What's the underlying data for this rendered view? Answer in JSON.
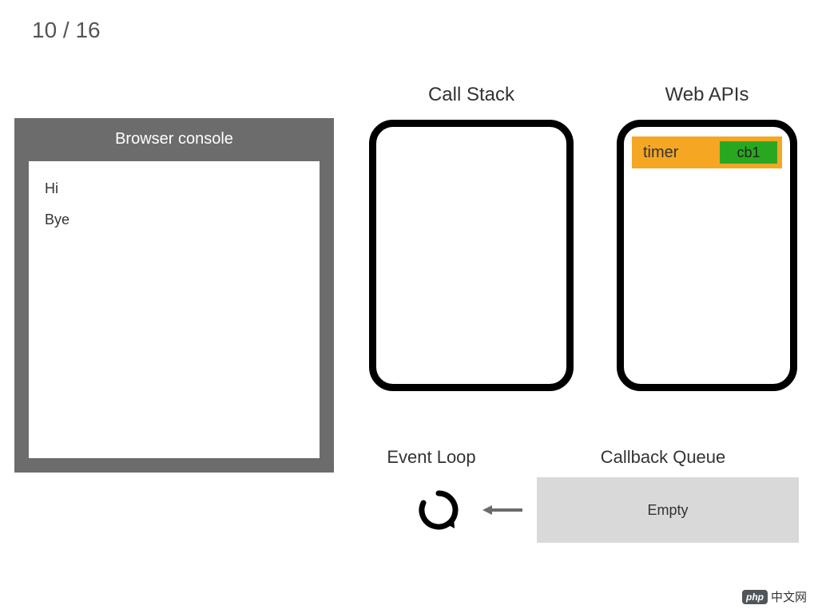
{
  "page": {
    "current": 10,
    "total": 16,
    "label": "10 / 16"
  },
  "console": {
    "title": "Browser console",
    "lines": [
      "Hi",
      "Bye"
    ]
  },
  "sections": {
    "call_stack": "Call Stack",
    "web_apis": "Web APIs",
    "event_loop": "Event Loop",
    "callback_queue": "Callback Queue"
  },
  "web_apis_entries": [
    {
      "label": "timer",
      "callback": "cb1"
    }
  ],
  "callback_queue": {
    "status": "Empty"
  },
  "colors": {
    "console_frame": "#6c6c6c",
    "timer_bg": "#f5a623",
    "callback_bg": "#2aa721",
    "queue_bg": "#d9d9d9"
  },
  "watermark": {
    "logo": "php",
    "text": "中文网"
  }
}
